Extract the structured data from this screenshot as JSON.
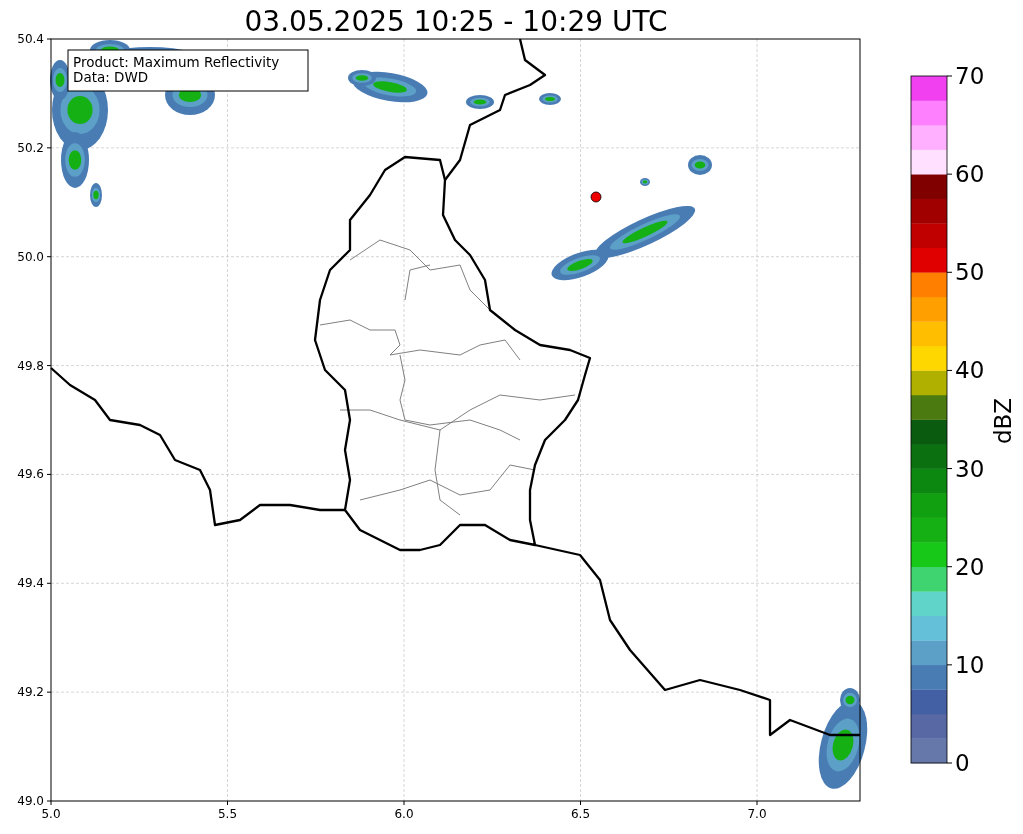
{
  "title": "03.05.2025 10:25 - 10:29 UTC",
  "legend": [
    "Product: Maximum Reflectivity",
    "Data: DWD"
  ],
  "x_ticks": [
    "5.0",
    "5.5",
    "6.0",
    "6.5",
    "7.0"
  ],
  "y_ticks": [
    "50.4",
    "50.2",
    "50.0",
    "49.8",
    "49.6",
    "49.4",
    "49.2",
    "49.0"
  ],
  "colorbar": {
    "label": "dBZ",
    "ticks": [
      "70",
      "60",
      "50",
      "40",
      "30",
      "20",
      "10",
      "0"
    ],
    "segments": [
      {
        "color": "#6677aa"
      },
      {
        "color": "#5868a4"
      },
      {
        "color": "#4460a4"
      },
      {
        "color": "#4a7cb4"
      },
      {
        "color": "#5ca0c8"
      },
      {
        "color": "#64c0d8"
      },
      {
        "color": "#60d4c8"
      },
      {
        "color": "#40d470"
      },
      {
        "color": "#18c818"
      },
      {
        "color": "#14b014"
      },
      {
        "color": "#10a010"
      },
      {
        "color": "#0c8810"
      },
      {
        "color": "#0a7010"
      },
      {
        "color": "#0a5a10"
      },
      {
        "color": "#4a7a10"
      },
      {
        "color": "#b0b000"
      },
      {
        "color": "#ffd700"
      },
      {
        "color": "#ffbf00"
      },
      {
        "color": "#ff9f00"
      },
      {
        "color": "#ff7f00"
      },
      {
        "color": "#e00000"
      },
      {
        "color": "#c00000"
      },
      {
        "color": "#a00000"
      },
      {
        "color": "#800000"
      },
      {
        "color": "#ffe0ff"
      },
      {
        "color": "#ffb0ff"
      },
      {
        "color": "#ff80ff"
      },
      {
        "color": "#f040f0"
      }
    ]
  }
}
